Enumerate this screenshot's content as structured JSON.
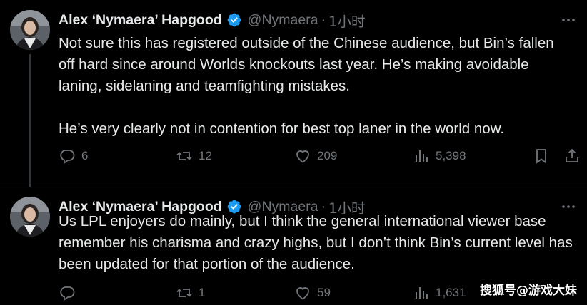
{
  "tweets": [
    {
      "author_name": "Alex ‘Nymaera’ Hapgood",
      "handle": "@Nymaera",
      "separator": "·",
      "time": "1小时",
      "paragraphs": [
        "Not sure this has registered outside of the Chinese audience, but Bin’s fallen off hard since around Worlds knockouts last year. He’s making avoidable laning, sidelaning and teamfighting mistakes.",
        "He’s very clearly not in contention for best top laner in the world now."
      ],
      "replies": "6",
      "retweets": "12",
      "likes": "209",
      "views": "5,398"
    },
    {
      "author_name": "Alex ‘Nymaera’ Hapgood",
      "handle": "@Nymaera",
      "separator": "·",
      "time": "1小时",
      "paragraphs": [
        "Us LPL enjoyers do mainly, but I think the general international viewer base remember his charisma and crazy highs, but I don’t think Bin’s current level has been updated for that portion of the audience."
      ],
      "replies": "",
      "retweets": "1",
      "likes": "59",
      "views": "1,631"
    }
  ],
  "watermark": "搜狐号@游戏大妹",
  "colors": {
    "background": "#000000",
    "text": "#e7e9ea",
    "muted": "#71767b",
    "verified": "#1d9bf0",
    "divider": "#2f3336"
  },
  "icons": [
    "avatar",
    "verified-badge-icon",
    "more-icon",
    "reply-icon",
    "retweet-icon",
    "like-icon",
    "views-icon",
    "bookmark-icon",
    "share-icon"
  ]
}
